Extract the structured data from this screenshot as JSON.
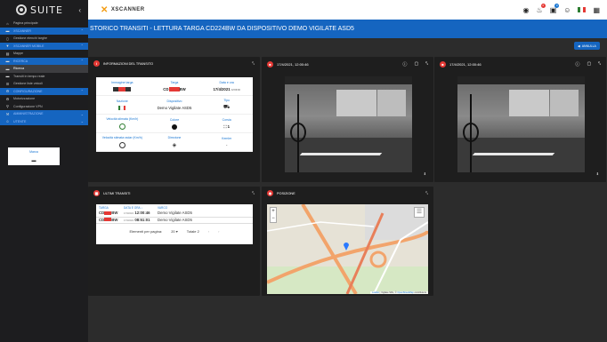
{
  "sidebar": {
    "logo_text": "SUITE",
    "collapse_icon": "chevron-left-icon",
    "items": [
      {
        "label": "Pagina principale",
        "icon": "home-icon",
        "style": "normal"
      },
      {
        "label": "XSCANNER",
        "icon": "car-icon",
        "style": "blue",
        "chevron": "^"
      },
      {
        "label": "Gestione elenchi targhe",
        "icon": "doc-icon",
        "style": "normal"
      },
      {
        "label": "XSCANNER MOBILE",
        "icon": "filter-icon",
        "style": "blue",
        "chevron": "^"
      },
      {
        "label": "Mappe",
        "icon": "map-icon",
        "style": "normal"
      },
      {
        "label": "RICERCA",
        "icon": "car-icon",
        "style": "blue",
        "chevron": "^"
      },
      {
        "label": "Ricerca",
        "icon": "car-icon",
        "style": "active"
      },
      {
        "label": "Transiti in tempo reale",
        "icon": "car-icon",
        "style": "normal"
      },
      {
        "label": "Gestione liste veicoli",
        "icon": "list-icon",
        "style": "normal"
      },
      {
        "label": "CONFIGURAZIONE",
        "icon": "gear-icon",
        "style": "blue",
        "chevron": "^"
      },
      {
        "label": "Motorizzazione",
        "icon": "gear-icon",
        "style": "normal"
      },
      {
        "label": "Configurazione VPN",
        "icon": "key-icon",
        "style": "normal"
      },
      {
        "label": "AMMINISTRAZIONE",
        "icon": "wrench-icon",
        "style": "blue",
        "chevron": "v"
      },
      {
        "label": "UTENTE",
        "icon": "user-icon",
        "style": "blue",
        "chevron": "v"
      }
    ]
  },
  "topbar": {
    "brand": "XSCANNER",
    "notif_badge_1": "2",
    "notif_badge_2": "0"
  },
  "page_title": "STORICO TRANSITI - LETTURA TARGA CD224BW DA DISPOSITIVO DEMO VIGILATE ASD5",
  "undo_label": "ANNULLA",
  "info_panel": {
    "title": "INFORMAZIONI DEL TRANSITO",
    "fields": [
      {
        "label": "Immagine targa",
        "value": ""
      },
      {
        "label": "Targa",
        "value": "CD"
      },
      {
        "label": "Data e ora",
        "value": "17/4/2021",
        "extra": "12:00:46"
      },
      {
        "label": "Nazione",
        "value": ""
      },
      {
        "label": "Dispositivo",
        "value": "Demo Vigilate ASD5"
      },
      {
        "label": "Tipo",
        "value": ""
      },
      {
        "label": "Velocità stimata (Km/h)",
        "value": ""
      },
      {
        "label": "Colore",
        "value": ""
      },
      {
        "label": "Corsia",
        "value": "1"
      },
      {
        "label": "Velocità stimata radar (Km/h)",
        "value": ""
      },
      {
        "label": "Direzione",
        "value": ""
      },
      {
        "label": "Kemler",
        "value": "-"
      }
    ],
    "brand_label": "Marca"
  },
  "camera_1": {
    "timestamp": "17/4/2021, 12:00:46"
  },
  "camera_2": {
    "timestamp": "17/4/2021, 12:00:46"
  },
  "transits": {
    "title": "ULTIMI TRANSITI",
    "headers": [
      "TARGA",
      "DATA E ORA",
      "VARCO"
    ],
    "rows": [
      {
        "plate": "CD",
        "plate_end": "BW",
        "date_small": "17/4/2021",
        "time": "12:00:46",
        "gate": "Demo Vigilate ASD5"
      },
      {
        "plate": "CD",
        "plate_end": "BW",
        "date_small": "17/4/2021",
        "time": "08:51:01",
        "gate": "Demo Vigilate ASD5"
      }
    ],
    "per_page_label": "Elementi per pagina:",
    "per_page_value": "20",
    "total_label": "Totale 2"
  },
  "map_panel": {
    "title": "POSIZIONE",
    "attribution_leaflet": "Leaflet",
    "attribution_mid": "| Vigilate SRL, ©",
    "attribution_osm": "OpenStreetMap",
    "attribution_end": "contributors"
  },
  "colors": {
    "accent": "#1565c0",
    "alert": "#e53935"
  }
}
